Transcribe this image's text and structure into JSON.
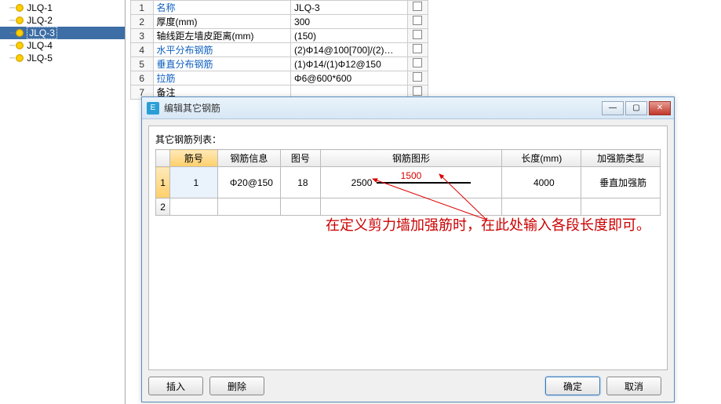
{
  "sidebar": {
    "items": [
      {
        "label": "JLQ-1"
      },
      {
        "label": "JLQ-2"
      },
      {
        "label": "JLQ-3"
      },
      {
        "label": "JLQ-4"
      },
      {
        "label": "JLQ-5"
      }
    ],
    "selected_index": 2
  },
  "props": {
    "rows": [
      {
        "n": "1",
        "name": "名称",
        "val": "JLQ-3",
        "link": true
      },
      {
        "n": "2",
        "name": "厚度(mm)",
        "val": "300"
      },
      {
        "n": "3",
        "name": "轴线距左墙皮距离(mm)",
        "val": "(150)"
      },
      {
        "n": "4",
        "name": "水平分布钢筋",
        "val": "(2)Φ14@100[700]/(2)…",
        "link": true
      },
      {
        "n": "5",
        "name": "垂直分布钢筋",
        "val": "(1)Φ14/(1)Φ12@150",
        "link": true
      },
      {
        "n": "6",
        "name": "拉筋",
        "val": "Φ6@600*600",
        "link": true
      },
      {
        "n": "7",
        "name": "备注",
        "val": ""
      }
    ]
  },
  "dialog": {
    "title": "编辑其它钢筋",
    "list_label": "其它钢筋列表：",
    "headers": {
      "num": "筋号",
      "info": "钢筋信息",
      "fig": "图号",
      "shape": "钢筋图形",
      "len": "长度(mm)",
      "type": "加强筋类型"
    },
    "rows": [
      {
        "rn": "1",
        "num": "1",
        "info": "Φ20@150",
        "fig": "18",
        "shape_left": "2500",
        "shape_mid": "1500",
        "len": "4000",
        "type": "垂直加强筋"
      },
      {
        "rn": "2",
        "num": "",
        "info": "",
        "fig": "",
        "shape_left": "",
        "shape_mid": "",
        "len": "",
        "type": ""
      }
    ],
    "buttons": {
      "insert": "插入",
      "delete": "删除",
      "ok": "确定",
      "cancel": "取消"
    },
    "annotation": "在定义剪力墙加强筋时，在此处输入各段长度即可。"
  }
}
